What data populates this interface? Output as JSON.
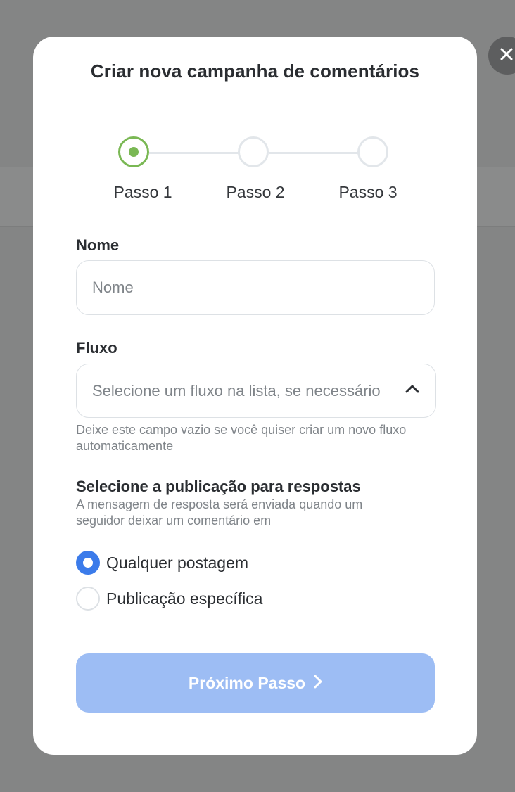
{
  "modal": {
    "title": "Criar nova campanha de comentários"
  },
  "stepper": {
    "steps": [
      {
        "label": "Passo 1",
        "state": "active"
      },
      {
        "label": "Passo 2",
        "state": "inactive"
      },
      {
        "label": "Passo 3",
        "state": "inactive"
      }
    ]
  },
  "form": {
    "name": {
      "label": "Nome",
      "placeholder": "Nome",
      "value": ""
    },
    "flow": {
      "label": "Fluxo",
      "placeholder": "Selecione um fluxo na lista, se necessário",
      "help": "Deixe este campo vazio se você quiser criar um novo fluxo automaticamente",
      "icon": "chevron-up-icon"
    },
    "publication": {
      "title": "Selecione a publicação para respostas",
      "description": "A mensagem de resposta será enviada quando um seguidor deixar um comentário em",
      "options": [
        {
          "label": "Qualquer postagem",
          "checked": true
        },
        {
          "label": "Publicação específica",
          "checked": false
        }
      ]
    }
  },
  "actions": {
    "next_label": "Próximo Passo",
    "next_icon": "chevron-right-icon",
    "close_icon": "close-icon"
  },
  "colors": {
    "step_active": "#7ab854",
    "radio_checked": "#3b7bea",
    "next_button_disabled": "#9dbdf4",
    "overlay": "#848585"
  }
}
